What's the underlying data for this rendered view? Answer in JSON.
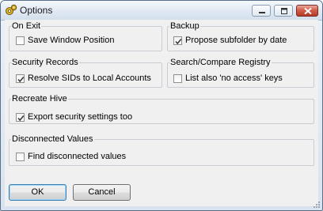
{
  "window": {
    "title": "Options"
  },
  "icons": {
    "app": "gear-icon",
    "minimize": "minimize-icon",
    "maximize": "maximize-icon",
    "close": "close-icon",
    "checkmark": "checkmark-icon"
  },
  "groups": {
    "on_exit": {
      "title": "On Exit",
      "option": {
        "label": "Save Window Position",
        "checked": false
      }
    },
    "backup": {
      "title": "Backup",
      "option": {
        "label": "Propose subfolder by date",
        "checked": true
      }
    },
    "security_records": {
      "title": "Security Records",
      "option": {
        "label": "Resolve SIDs to Local Accounts",
        "checked": true
      }
    },
    "search_compare": {
      "title": "Search/Compare Registry",
      "option": {
        "label": "List also 'no access' keys",
        "checked": false
      }
    },
    "recreate_hive": {
      "title": "Recreate Hive",
      "option": {
        "label": "Export security settings too",
        "checked": true
      }
    },
    "disconnected_values": {
      "title": "Disconnected Values",
      "option": {
        "label": "Find disconnected values",
        "checked": false
      }
    }
  },
  "buttons": {
    "ok": "OK",
    "cancel": "Cancel"
  },
  "colors": {
    "close_button": "#c8452f",
    "default_button_border": "#3c7fb1",
    "checkmark": "#3a3a3a"
  }
}
